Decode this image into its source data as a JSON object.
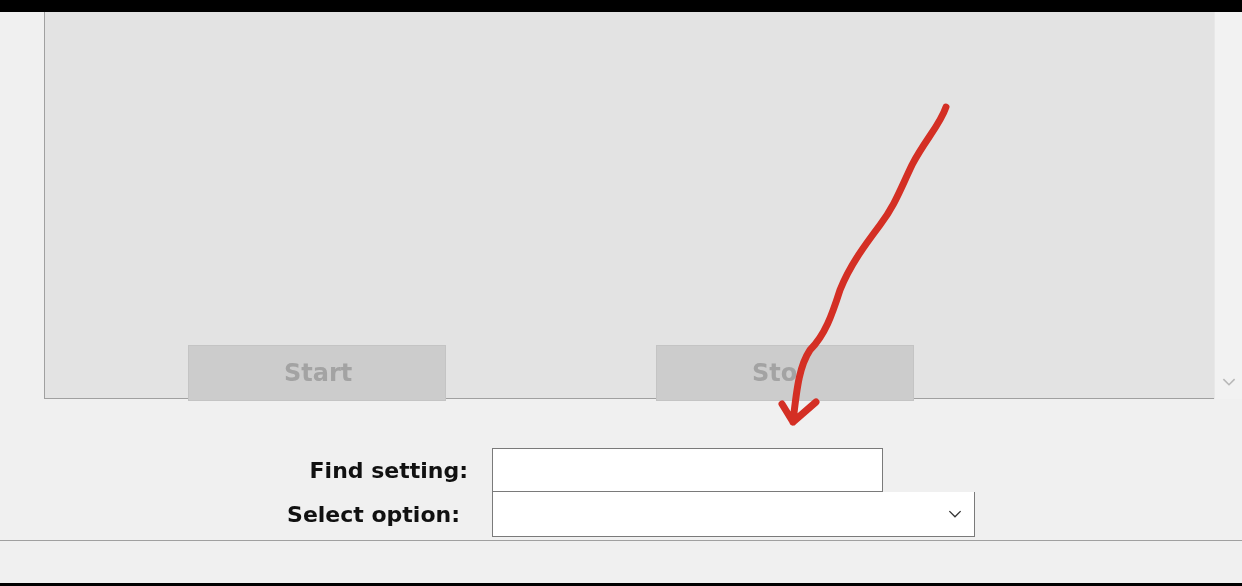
{
  "panel": {
    "buttons": [
      {
        "label": "Start",
        "disabled": true
      },
      {
        "label": "Sto",
        "disabled": true
      }
    ]
  },
  "form": {
    "fields": [
      {
        "kind": "text",
        "label": "Find setting:"
      },
      {
        "kind": "dropdown",
        "label": "Select option:"
      }
    ]
  },
  "annotation": {
    "kind": "arrow"
  }
}
